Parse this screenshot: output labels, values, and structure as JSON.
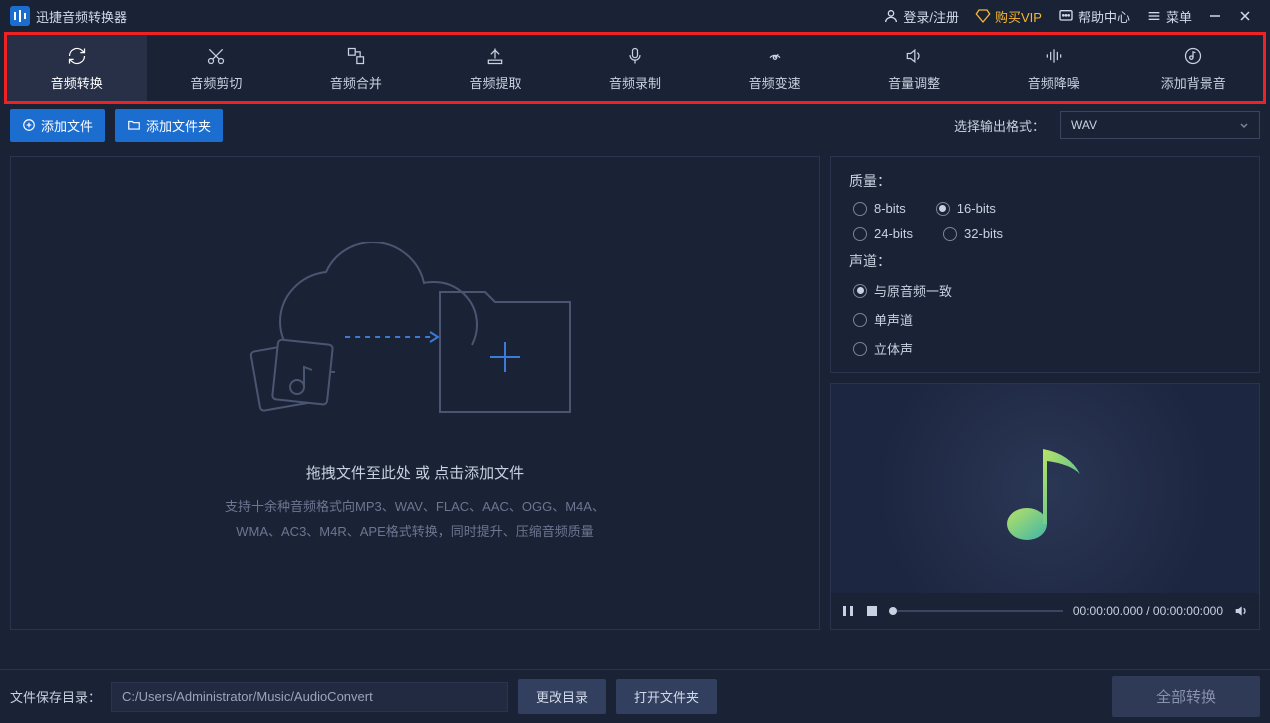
{
  "app": {
    "title": "迅捷音频转换器"
  },
  "titlebar": {
    "login": "登录/注册",
    "vip": "购买VIP",
    "help": "帮助中心",
    "menu": "菜单"
  },
  "toolbar": {
    "tabs": [
      {
        "label": "音频转换",
        "icon": "refresh-icon"
      },
      {
        "label": "音频剪切",
        "icon": "scissors-icon"
      },
      {
        "label": "音频合并",
        "icon": "merge-icon"
      },
      {
        "label": "音频提取",
        "icon": "extract-icon"
      },
      {
        "label": "音频录制",
        "icon": "mic-icon"
      },
      {
        "label": "音频变速",
        "icon": "speed-icon"
      },
      {
        "label": "音量调整",
        "icon": "volume-icon"
      },
      {
        "label": "音频降噪",
        "icon": "denoise-icon"
      },
      {
        "label": "添加背景音",
        "icon": "bgm-icon"
      }
    ]
  },
  "actionbar": {
    "addFile": "添加文件",
    "addFolder": "添加文件夹",
    "formatLabel": "选择输出格式：",
    "formatValue": "WAV"
  },
  "dropzone": {
    "title": "拖拽文件至此处 或 点击添加文件",
    "sub1": "支持十余种音频格式向MP3、WAV、FLAC、AAC、OGG、M4A、",
    "sub2": "WMA、AC3、M4R、APE格式转换，同时提升、压缩音频质量"
  },
  "settings": {
    "qualityLabel": "质量：",
    "quality": [
      "8-bits",
      "16-bits",
      "24-bits",
      "32-bits"
    ],
    "qualitySelected": "16-bits",
    "channelLabel": "声道：",
    "channels": [
      "与原音频一致",
      "单声道",
      "立体声"
    ],
    "channelSelected": "与原音频一致"
  },
  "preview": {
    "time": "00:00:00.000 / 00:00:00:000"
  },
  "bottom": {
    "pathLabel": "文件保存目录：",
    "path": "C:/Users/Administrator/Music/AudioConvert",
    "changeDir": "更改目录",
    "openDir": "打开文件夹",
    "convertAll": "全部转换"
  }
}
